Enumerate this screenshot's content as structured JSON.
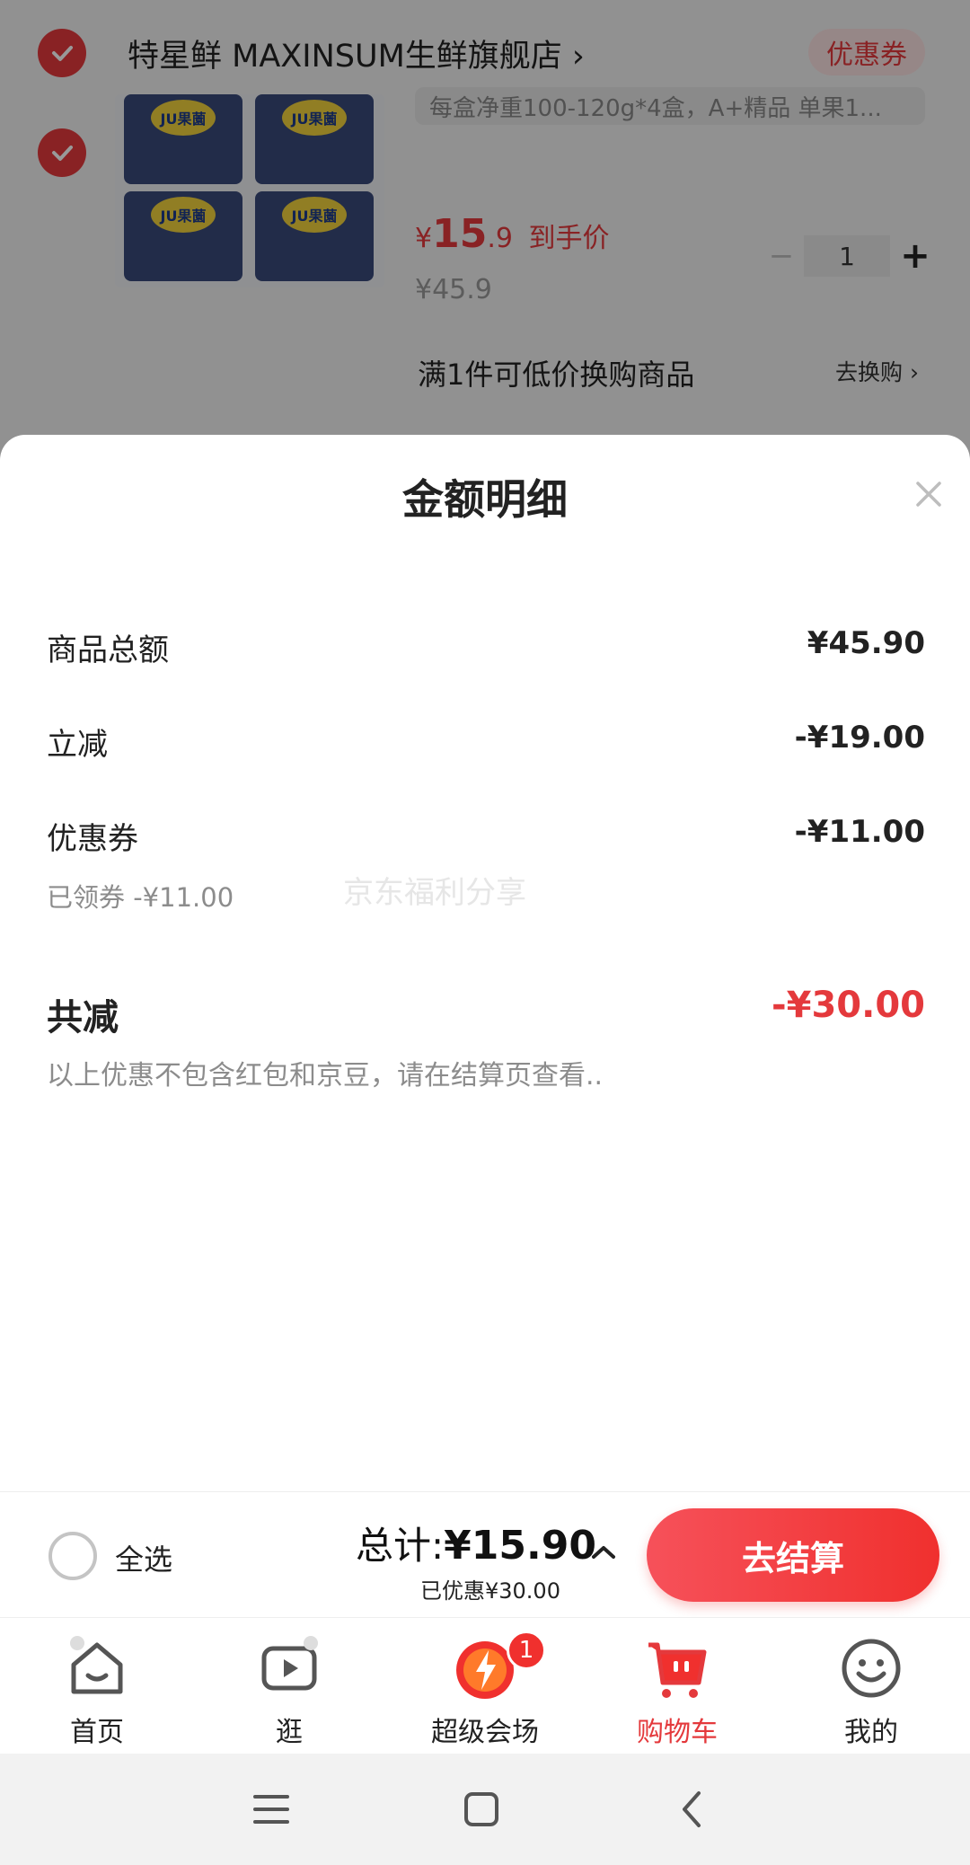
{
  "background": {
    "store": {
      "name": "特星鲜 MAXINSUM生鲜旗舰店 ›",
      "coupon_label": "优惠券"
    },
    "product": {
      "image_brand": "JU果薗",
      "spec": "每盒净重100-120g*4盒，A+精品 单果1...",
      "currency_symbol": "¥",
      "price_int": "15",
      "price_dec": ".9",
      "price_suffix": "到手价",
      "original_price": "¥45.9",
      "quantity": "1",
      "minus": "−",
      "plus": "+"
    },
    "exchange": {
      "text": "满1件可低价换购商品",
      "link": "去换购 ›"
    }
  },
  "sheet": {
    "title": "金额明细",
    "rows": [
      {
        "label": "商品总额",
        "value": "¥45.90"
      },
      {
        "label": "立减",
        "value": "-¥19.00"
      },
      {
        "label": "优惠券",
        "value": "-¥11.00"
      }
    ],
    "coupon_note": "已领券 -¥11.00",
    "watermark": "京东福利分享",
    "total_label": "共减",
    "total_value": "-¥30.00",
    "disclaimer": "以上优惠不包含红包和京豆，请在结算页查看.."
  },
  "settle": {
    "select_all": "全选",
    "total_prefix": "总计:",
    "total": "¥15.90",
    "saved": "已优惠¥30.00",
    "checkout": "去结算"
  },
  "tabs": [
    {
      "label": "首页",
      "icon": "home-icon"
    },
    {
      "label": "逛",
      "icon": "play-icon"
    },
    {
      "label": "超级会场",
      "icon": "super-venue-icon",
      "badge": "1"
    },
    {
      "label": "购物车",
      "icon": "cart-icon",
      "active": true
    },
    {
      "label": "我的",
      "icon": "smile-icon"
    }
  ],
  "colors": {
    "accent": "#e4393c",
    "checkout": "#f0302e"
  }
}
